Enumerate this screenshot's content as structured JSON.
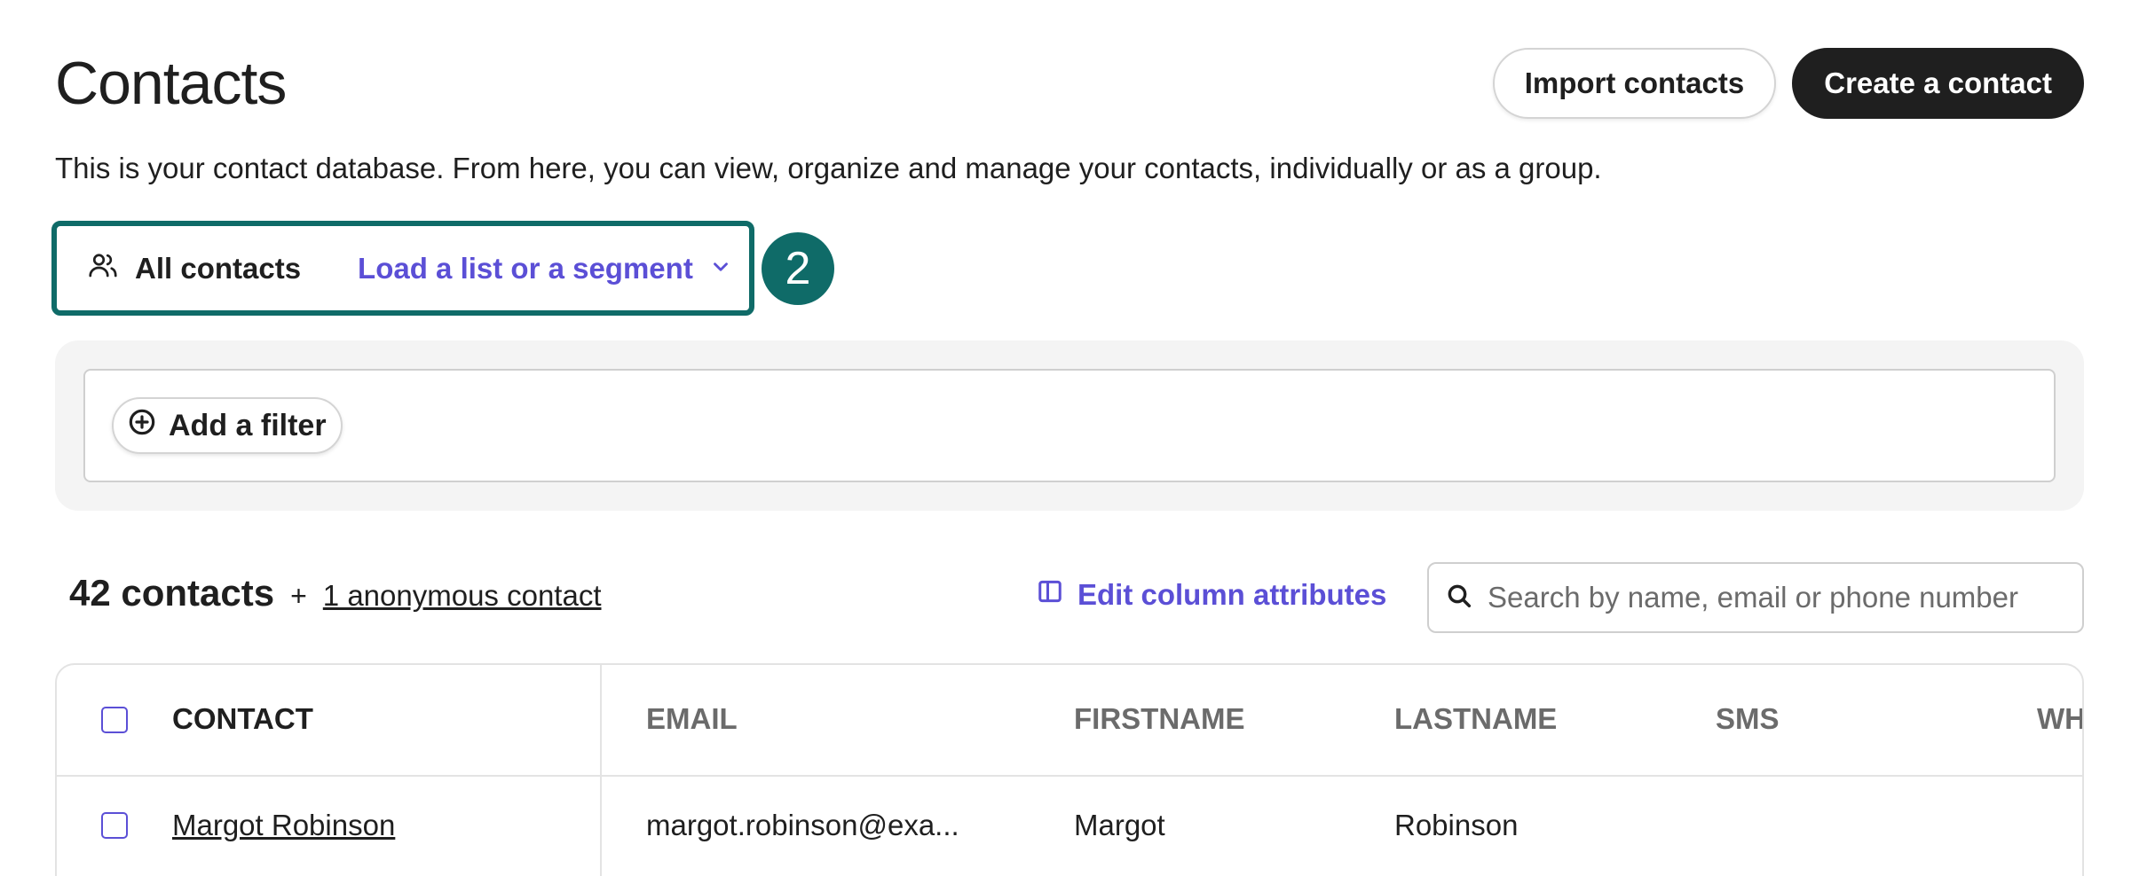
{
  "header": {
    "title": "Contacts",
    "import_label": "Import contacts",
    "create_label": "Create a contact",
    "description": "This is your contact database. From here, you can view, organize and manage your contacts, individually or as a group."
  },
  "selector": {
    "all_contacts_label": "All contacts",
    "load_list_label": "Load a list or a segment",
    "step_number": "2",
    "icons": [
      "users-icon",
      "chevron-down-icon"
    ]
  },
  "filters": {
    "add_filter_label": "Add a filter"
  },
  "summary": {
    "count_label": "42 contacts",
    "plus": "+",
    "anonymous_label": "1 anonymous contact"
  },
  "toolbar": {
    "edit_columns_label": "Edit column attributes",
    "search_placeholder": "Search by name, email or phone number"
  },
  "table": {
    "headers": [
      "CONTACT",
      "EMAIL",
      "FIRSTNAME",
      "LASTNAME",
      "SMS",
      "WHA"
    ],
    "rows": [
      {
        "contact": "Margot Robinson",
        "email": "margot.robinson@exa...",
        "firstname": "Margot",
        "lastname": "Robinson",
        "sms": "",
        "wha": ""
      }
    ]
  },
  "colors": {
    "accent": "#5b4fd6",
    "highlight": "#0f6b68",
    "text": "#1f1f1f",
    "muted": "#6b6b6b"
  }
}
